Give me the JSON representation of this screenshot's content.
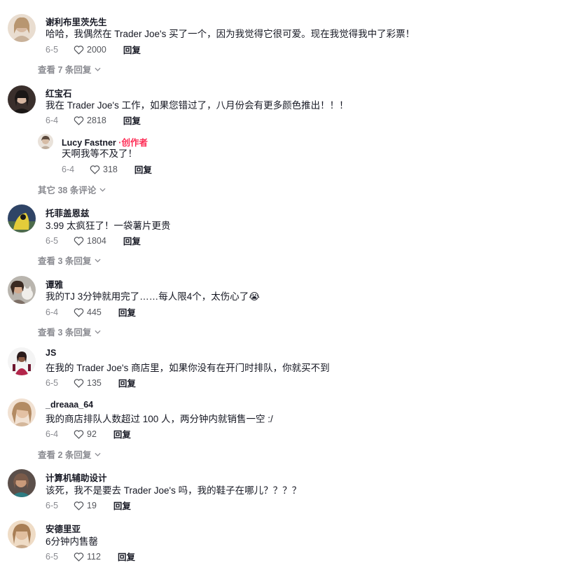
{
  "comments": [
    {
      "username": "谢利布里茨先生",
      "text": "哈哈，我偶然在 Trader Joe's 买了一个，因为我觉得它很可爱。现在我觉得我中了彩票！",
      "date": "6-5",
      "likes": "2000",
      "reply_label": "回复",
      "more": "查看 7 条回复",
      "avatar_colors": [
        "#c9b29a",
        "#e7d8c6"
      ]
    },
    {
      "username": "红宝石",
      "text": "我在 Trader Joe's 工作，如果您错过了，八月份会有更多颜色推出！！！",
      "date": "6-4",
      "likes": "2818",
      "reply_label": "回复",
      "avatar_colors": [
        "#1b1716",
        "#d8b7a2"
      ]
    },
    {
      "username": "托菲盖恩兹",
      "text": "3.99 太疯狂了！一袋薯片更贵",
      "date": "6-5",
      "likes": "1804",
      "reply_label": "回复",
      "more": "查看 3 条回复",
      "avatar_colors": [
        "#2f4466",
        "#e3cc3a"
      ]
    },
    {
      "username": "谭雅",
      "text": "我的TJ 3分钟就用完了……每人限4个，太伤心了😭",
      "date": "6-4",
      "likes": "445",
      "reply_label": "回复",
      "more": "查看 3 条回复",
      "avatar_colors": [
        "#9d9a95",
        "#e8e5e0"
      ]
    },
    {
      "username": "JS",
      "text": "在我的 Trader Joe's 商店里，如果你没有在开门时排队，你就买不到",
      "date": "6-5",
      "likes": "135",
      "reply_label": "回复",
      "avatar_colors": [
        "#f4f4f4",
        "#2a1b1b"
      ]
    },
    {
      "username": "_dreaaa_64",
      "text": "我的商店排队人数超过 100 人，两分钟内就销售一空 :/",
      "date": "6-4",
      "likes": "92",
      "reply_label": "回复",
      "more": "查看 2 条回复",
      "avatar_colors": [
        "#d4b79b",
        "#f1e1d2"
      ]
    },
    {
      "username": "计算机辅助设计",
      "text": "该死，我不是要去 Trader Joe's 吗，我的鞋子在哪儿？？？？",
      "date": "6-5",
      "likes": "19",
      "reply_label": "回复",
      "avatar_colors": [
        "#7a5b4a",
        "#c99a7a"
      ]
    },
    {
      "username": "安德里亚",
      "text": "6分钟内售罄",
      "date": "6-5",
      "likes": "112",
      "reply_label": "回复",
      "avatar_colors": [
        "#c8a98a",
        "#efdcc6"
      ]
    }
  ],
  "creator_reply": {
    "username": "Lucy Fastner",
    "creator_label": "·创作者",
    "text": "天啊我等不及了！",
    "date": "6-4",
    "likes": "318",
    "reply_label": "回复",
    "avatar_colors": [
      "#bfae9d",
      "#e9e2da"
    ]
  },
  "other_comments_label": "其它 38 条评论",
  "colors": {
    "text": "#161823",
    "muted": "#8a8b91",
    "creator": "#fe2c55"
  },
  "icons": {
    "like": "heart-outline-icon",
    "expand": "chevron-down-icon"
  }
}
